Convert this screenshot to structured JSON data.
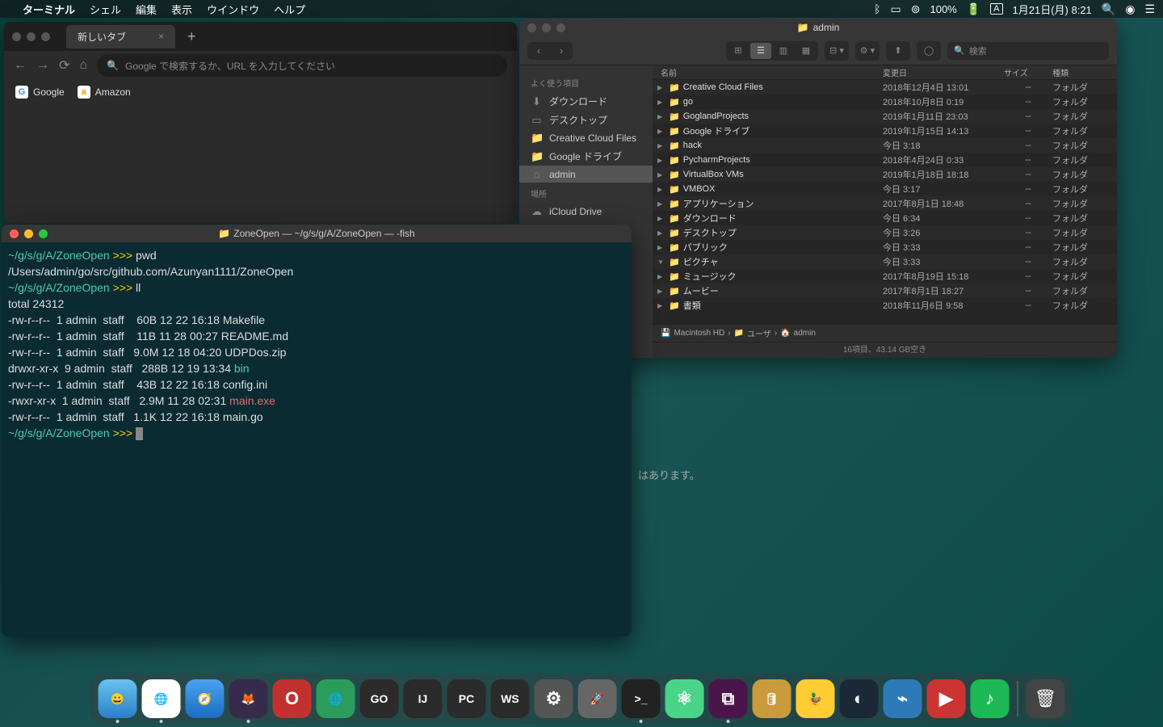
{
  "menubar": {
    "app": "ターミナル",
    "items": [
      "シェル",
      "編集",
      "表示",
      "ウインドウ",
      "ヘルプ"
    ],
    "battery": "100%",
    "input": "A",
    "datetime": "1月21日(月) 8:21"
  },
  "browser": {
    "tab_title": "新しいタブ",
    "omnibox_placeholder": "Google で検索するか、URL を入力してください",
    "bookmarks": [
      {
        "icon": "G",
        "label": "Google"
      },
      {
        "icon": "a",
        "label": "Amazon"
      }
    ]
  },
  "finder": {
    "title": "admin",
    "search_placeholder": "検索",
    "sidebar": {
      "favorites_header": "よく使う項目",
      "favorites": [
        {
          "icon": "⬇",
          "label": "ダウンロード"
        },
        {
          "icon": "▭",
          "label": "デスクトップ"
        },
        {
          "icon": "📁",
          "label": "Creative Cloud Files"
        },
        {
          "icon": "📁",
          "label": "Google ドライブ"
        },
        {
          "icon": "⌂",
          "label": "admin",
          "active": true
        }
      ],
      "locations_header": "場所",
      "locations": [
        {
          "icon": "☁",
          "label": "iCloud Drive"
        }
      ]
    },
    "columns": {
      "name": "名前",
      "date": "変更日",
      "size": "サイズ",
      "kind": "種類"
    },
    "rows": [
      {
        "disc": "▶",
        "name": "Creative Cloud Files",
        "date": "2018年12月4日 13:01",
        "size": "--",
        "kind": "フォルダ"
      },
      {
        "disc": "▶",
        "name": "go",
        "date": "2018年10月8日 0:19",
        "size": "--",
        "kind": "フォルダ"
      },
      {
        "disc": "▶",
        "name": "GoglandProjects",
        "date": "2019年1月11日 23:03",
        "size": "--",
        "kind": "フォルダ"
      },
      {
        "disc": "▶",
        "name": "Google ドライブ",
        "date": "2019年1月15日 14:13",
        "size": "--",
        "kind": "フォルダ"
      },
      {
        "disc": "▶",
        "name": "hack",
        "date": "今日 3:18",
        "size": "--",
        "kind": "フォルダ"
      },
      {
        "disc": "▶",
        "name": "PycharmProjects",
        "date": "2018年4月24日 0:33",
        "size": "--",
        "kind": "フォルダ"
      },
      {
        "disc": "▶",
        "name": "VirtualBox VMs",
        "date": "2019年1月18日 18:18",
        "size": "--",
        "kind": "フォルダ"
      },
      {
        "disc": "▶",
        "name": "VMBOX",
        "date": "今日 3:17",
        "size": "--",
        "kind": "フォルダ"
      },
      {
        "disc": "▶",
        "name": "アプリケーション",
        "date": "2017年8月1日 18:48",
        "size": "--",
        "kind": "フォルダ"
      },
      {
        "disc": "▶",
        "name": "ダウンロード",
        "date": "今日 6:34",
        "size": "--",
        "kind": "フォルダ"
      },
      {
        "disc": "▶",
        "name": "デスクトップ",
        "date": "今日 3:26",
        "size": "--",
        "kind": "フォルダ"
      },
      {
        "disc": "▶",
        "name": "パブリック",
        "date": "今日 3:33",
        "size": "--",
        "kind": "フォルダ"
      },
      {
        "disc": "▼",
        "name": "ピクチャ",
        "date": "今日 3:33",
        "size": "--",
        "kind": "フォルダ"
      },
      {
        "disc": "▶",
        "name": "ミュージック",
        "date": "2017年8月19日 15:18",
        "size": "--",
        "kind": "フォルダ"
      },
      {
        "disc": "▶",
        "name": "ムービー",
        "date": "2017年8月1日 18:27",
        "size": "--",
        "kind": "フォルダ"
      },
      {
        "disc": "▶",
        "name": "書類",
        "date": "2018年11月6日 9:58",
        "size": "--",
        "kind": "フォルダ"
      }
    ],
    "path": [
      "Macintosh HD",
      "ユーザ",
      "admin"
    ],
    "status": "16項目、43.14 GB空き"
  },
  "terminal": {
    "title": "ZoneOpen — ~/g/s/g/A/ZoneOpen — -fish",
    "prompt_path": "~/g/s/g/A/ZoneOpen",
    "arrows": ">>>",
    "lines": [
      {
        "type": "prompt",
        "cmd": "pwd"
      },
      {
        "type": "out",
        "text": "/Users/admin/go/src/github.com/Azunyan1111/ZoneOpen"
      },
      {
        "type": "prompt",
        "cmd": "ll"
      },
      {
        "type": "out",
        "text": "total 24312"
      },
      {
        "type": "out",
        "text": "-rw-r--r--  1 admin  staff    60B 12 22 16:18 Makefile"
      },
      {
        "type": "out",
        "text": "-rw-r--r--  1 admin  staff    11B 11 28 00:27 README.md"
      },
      {
        "type": "out",
        "text": "-rw-r--r--  1 admin  staff   9.0M 12 18 04:20 UDPDos.zip"
      },
      {
        "type": "ls",
        "pre": "drwxr-xr-x  9 admin  staff   288B 12 19 13:34 ",
        "name": "bin",
        "cls": "dir-color"
      },
      {
        "type": "out",
        "text": "-rw-r--r--  1 admin  staff    43B 12 22 16:18 config.ini"
      },
      {
        "type": "ls",
        "pre": "-rwxr-xr-x  1 admin  staff   2.9M 11 28 02:31 ",
        "name": "main.exe",
        "cls": "exe-color"
      },
      {
        "type": "out",
        "text": "-rw-r--r--  1 admin  staff   1.1K 12 22 16:18 main.go"
      },
      {
        "type": "prompt",
        "cmd": ""
      }
    ]
  },
  "bg_text": "はあります。",
  "dock": [
    {
      "bg": "linear-gradient(#6ac3f0,#2a7fc8)",
      "glyph": "😀",
      "dot": true
    },
    {
      "bg": "#fff",
      "glyph": "🌐",
      "dot": true
    },
    {
      "bg": "linear-gradient(#4aa3f0,#1d6cc0)",
      "glyph": "🧭",
      "dot": false
    },
    {
      "bg": "#362b4a",
      "glyph": "🦊",
      "dot": true
    },
    {
      "bg": "#c23030",
      "glyph": "O",
      "dot": false
    },
    {
      "bg": "#2a9d5c",
      "glyph": "🌐",
      "dot": false
    },
    {
      "bg": "#2b2b2b",
      "glyph": "GO",
      "dot": false
    },
    {
      "bg": "#2b2b2b",
      "glyph": "IJ",
      "dot": false
    },
    {
      "bg": "#2b2b2b",
      "glyph": "PC",
      "dot": false
    },
    {
      "bg": "#2b2b2b",
      "glyph": "WS",
      "dot": false
    },
    {
      "bg": "#555",
      "glyph": "⚙",
      "dot": false
    },
    {
      "bg": "#666",
      "glyph": "🚀",
      "dot": false
    },
    {
      "bg": "#222",
      "glyph": ">_",
      "dot": true
    },
    {
      "bg": "#4ad48a",
      "glyph": "⚛",
      "dot": false
    },
    {
      "bg": "#4a154b",
      "glyph": "⧉",
      "dot": true
    },
    {
      "bg": "#c99b3a",
      "glyph": "🛢",
      "dot": false
    },
    {
      "bg": "#ffcc33",
      "glyph": "🦆",
      "dot": false
    },
    {
      "bg": "#1b2838",
      "glyph": "◐",
      "dot": false
    },
    {
      "bg": "#2c7bb8",
      "glyph": "⌁",
      "dot": false
    },
    {
      "bg": "#cc3333",
      "glyph": "▶",
      "dot": false
    },
    {
      "bg": "#1db954",
      "glyph": "♪",
      "dot": false
    }
  ]
}
